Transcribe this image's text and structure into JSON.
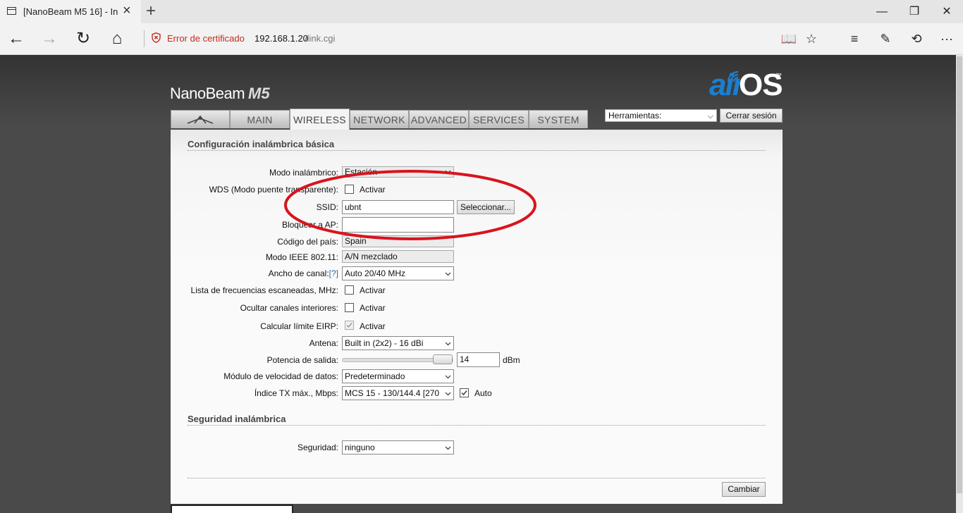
{
  "browser": {
    "tab_title": "[NanoBeam M5 16] - In",
    "cert_error": "Error de certificado",
    "url_host": "192.168.1.20",
    "url_path": "/link.cgi"
  },
  "header": {
    "product_name": "NanoBeam",
    "product_model": "M5",
    "brand_air": "air",
    "brand_os": "OS",
    "brand_tm": "™"
  },
  "nav": {
    "tabs": [
      {
        "label": ""
      },
      {
        "label": "MAIN"
      },
      {
        "label": "WIRELESS",
        "active": true
      },
      {
        "label": "NETWORK"
      },
      {
        "label": "ADVANCED"
      },
      {
        "label": "SERVICES"
      },
      {
        "label": "SYSTEM"
      }
    ],
    "tools_value": "Herramientas:",
    "logout_label": "Cerrar sesión"
  },
  "basic": {
    "section_title": "Configuración inalámbrica básica",
    "mode_label": "Modo inalámbrico:",
    "mode_value": "Estación",
    "wds_label": "WDS (Modo puente transparente):",
    "wds_checkbox_label": "Activar",
    "ssid_label": "SSID:",
    "ssid_value": "ubnt",
    "select_button": "Seleccionar...",
    "lock_ap_label": "Bloquear a AP:",
    "lock_ap_value": "",
    "country_label": "Código del país:",
    "country_value": "Spain",
    "ieee_label": "Modo IEEE 802.11:",
    "ieee_value": "A/N mezclado",
    "channel_width_label": "Ancho de canal:",
    "channel_width_help": "[?]",
    "channel_width_value": "Auto 20/40 MHz",
    "freq_list_label": "Lista de frecuencias escaneadas, MHz:",
    "freq_list_checkbox_label": "Activar",
    "hide_channels_label": "Ocultar canales interiores:",
    "hide_channels_checkbox_label": "Activar",
    "eirp_label": "Calcular límite EIRP:",
    "eirp_checkbox_label": "Activar",
    "antenna_label": "Antena:",
    "antenna_value": "Built in (2x2) - 16 dBi",
    "power_label": "Potencia de salida:",
    "power_value": "14",
    "power_unit": "dBm",
    "rate_module_label": "Módulo de velocidad de datos:",
    "rate_module_value": "Predeterminado",
    "max_tx_label": "Índice TX máx., Mbps:",
    "max_tx_value": "MCS 15 - 130/144.4 [270",
    "auto_label": "Auto"
  },
  "security": {
    "section_title": "Seguridad inalámbrica",
    "security_label": "Seguridad:",
    "security_value": "ninguno"
  },
  "footer": {
    "apply_button": "Cambiar"
  },
  "colors": {
    "accent_blue": "#1a7fd0",
    "cert_error_red": "#c42b1c",
    "annotation_red": "#d8141d"
  }
}
